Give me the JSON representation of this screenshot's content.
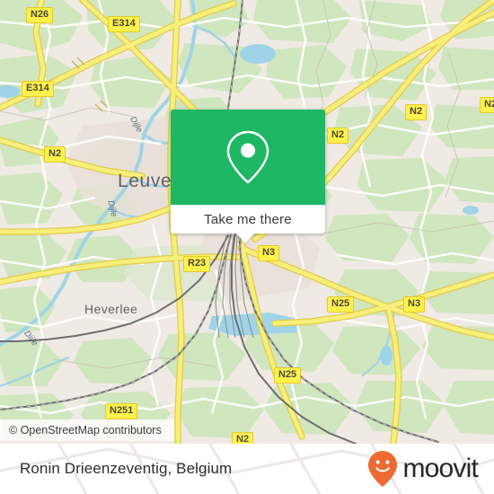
{
  "map": {
    "attribution": "© OpenStreetMap contributors",
    "cities": [
      {
        "name": "Leuven"
      },
      {
        "name": "Heverlee"
      }
    ],
    "rivers": [
      {
        "name": "Dijle"
      },
      {
        "name": "Dijle"
      },
      {
        "name": "Dijle"
      }
    ],
    "road_shields": [
      {
        "label": "N26"
      },
      {
        "label": "E314"
      },
      {
        "label": "E314"
      },
      {
        "label": "N2"
      },
      {
        "label": "N2"
      },
      {
        "label": "N2"
      },
      {
        "label": "N2"
      },
      {
        "label": "N2"
      },
      {
        "label": "R23"
      },
      {
        "label": "N3"
      },
      {
        "label": "N25"
      },
      {
        "label": "N3"
      },
      {
        "label": "N25"
      },
      {
        "label": "N251"
      }
    ],
    "colors": {
      "land": "#efeae3",
      "green_area": "#cfe6bd",
      "water": "#9fd4e8",
      "major_road": "#f5e96e",
      "road_casing": "#e8c828",
      "minor_road": "#ffffff",
      "railway": "#6b6b6b",
      "label_text": "#666266"
    }
  },
  "info_card": {
    "pin_icon": "location-pin-icon",
    "cta_label": "Take me there",
    "accent_color": "#1eb766"
  },
  "footer": {
    "place_name": "Ronin Drieenzeventig, Belgium",
    "brand_name": "moovit",
    "brand_icon": "moovit-smiley-pin-icon",
    "brand_color": "#ec6b33"
  }
}
